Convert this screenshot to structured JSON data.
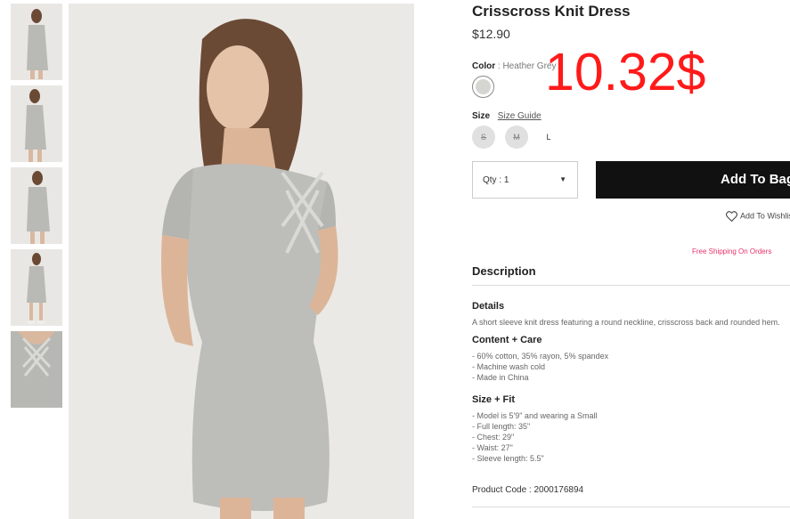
{
  "product": {
    "title": "Crisscross Knit Dress",
    "price": "$12.90",
    "overlay_price": "10.32$",
    "color_label": "Color",
    "color_value": "Heather Grey",
    "size_label": "Size",
    "size_guide": "Size Guide",
    "sizes": [
      "S",
      "M",
      "L"
    ],
    "qty_label": "Qty : 1",
    "add_button": "Add To Bag",
    "wishlist": "Add To Wishlist",
    "shipping": "Free Shipping On Orders",
    "description_heading": "Description",
    "details_heading": "Details",
    "details_text": "A short sleeve knit dress featuring a round neckline, crisscross back and rounded hem.",
    "content_heading": "Content + Care",
    "content_lines": [
      "- 60% cotton, 35% rayon, 5% spandex",
      "- Machine wash cold",
      "- Made in China"
    ],
    "fit_heading": "Size + Fit",
    "fit_lines": [
      "- Model is 5'9\" and wearing a Small",
      "- Full length: 35\"",
      "- Chest: 29\"",
      "- Waist: 27\"",
      "- Sleeve length: 5.5\""
    ],
    "product_code": "Product Code : 2000176894"
  },
  "colors": {
    "overlay": "#ff1a1a",
    "button": "#111111",
    "shipping": "#e8326b"
  }
}
